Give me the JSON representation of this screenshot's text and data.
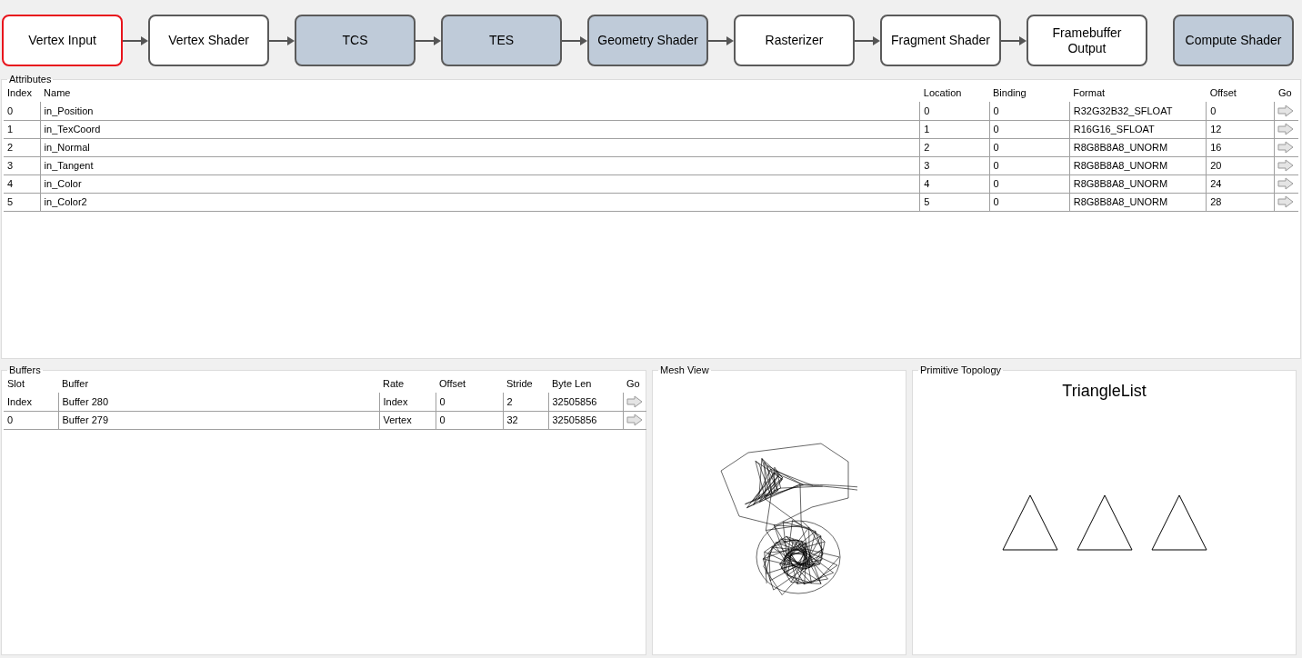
{
  "pipeline": {
    "stages": [
      {
        "label": "Vertex Input",
        "active": true,
        "selected": true
      },
      {
        "label": "Vertex Shader",
        "active": true,
        "selected": false
      },
      {
        "label": "TCS",
        "active": false,
        "selected": false
      },
      {
        "label": "TES",
        "active": false,
        "selected": false
      },
      {
        "label": "Geometry Shader",
        "active": false,
        "selected": false
      },
      {
        "label": "Rasterizer",
        "active": true,
        "selected": false
      },
      {
        "label": "Fragment Shader",
        "active": true,
        "selected": false
      },
      {
        "label": "Framebuffer Output",
        "active": true,
        "selected": false
      }
    ],
    "compute": {
      "label": "Compute Shader",
      "active": false,
      "selected": false
    }
  },
  "attributes": {
    "title": "Attributes",
    "columns": [
      "Index",
      "Name",
      "Location",
      "Binding",
      "Format",
      "Offset",
      "Go"
    ],
    "rows": [
      [
        "0",
        "in_Position",
        "0",
        "0",
        "R32G32B32_SFLOAT",
        "0"
      ],
      [
        "1",
        "in_TexCoord",
        "1",
        "0",
        "R16G16_SFLOAT",
        "12"
      ],
      [
        "2",
        "in_Normal",
        "2",
        "0",
        "R8G8B8A8_UNORM",
        "16"
      ],
      [
        "3",
        "in_Tangent",
        "3",
        "0",
        "R8G8B8A8_UNORM",
        "20"
      ],
      [
        "4",
        "in_Color",
        "4",
        "0",
        "R8G8B8A8_UNORM",
        "24"
      ],
      [
        "5",
        "in_Color2",
        "5",
        "0",
        "R8G8B8A8_UNORM",
        "28"
      ]
    ]
  },
  "buffers": {
    "title": "Buffers",
    "columns": [
      "Slot",
      "Buffer",
      "Rate",
      "Offset",
      "Stride",
      "Byte Len",
      "Go"
    ],
    "rows": [
      [
        "Index",
        "Buffer 280",
        "Index",
        "0",
        "2",
        "32505856"
      ],
      [
        "0",
        "Buffer 279",
        "Vertex",
        "0",
        "32",
        "32505856"
      ]
    ]
  },
  "mesh_view": {
    "title": "Mesh View"
  },
  "topology": {
    "title": "Primitive Topology",
    "value": "TriangleList"
  }
}
